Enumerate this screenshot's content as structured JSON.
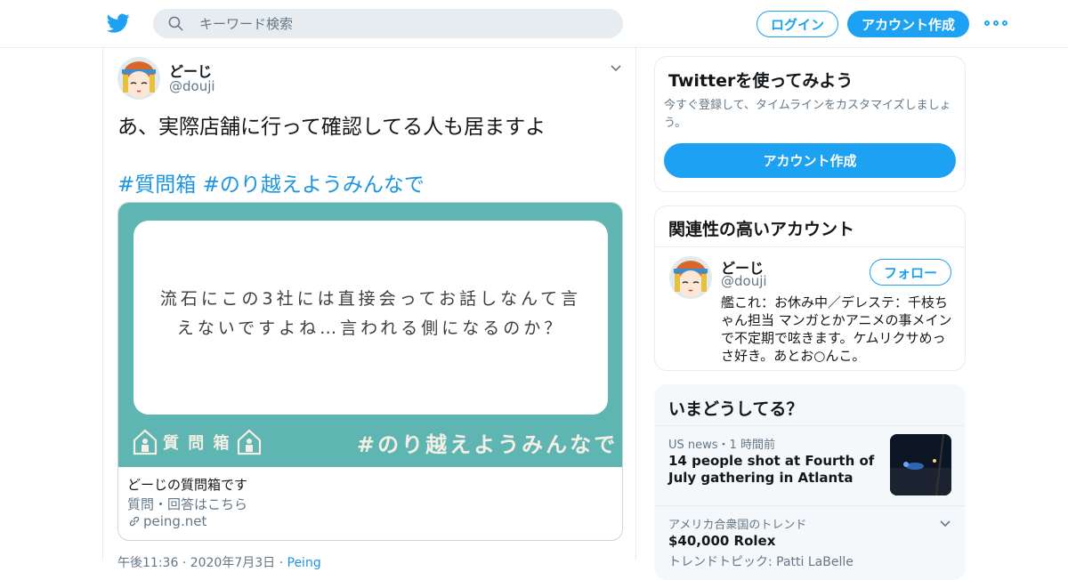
{
  "search": {
    "placeholder": "キーワード検索"
  },
  "header": {
    "login_label": "ログイン",
    "signup_label": "アカウント作成"
  },
  "tweet": {
    "name": "どーじ",
    "handle": "@douji",
    "text": "あ、実際店舗に行って確認してる人も居ますよ",
    "hashtags": "#質問箱 #のり越えようみんなで",
    "card": {
      "question_line1": "流石にこの3社には直接会ってお話しなんて言",
      "question_line2": "えないですよね…言われる側になるのか？",
      "brand": "質 問 箱",
      "hashtag": "#のり越えようみんなで",
      "title": "どーじの質問箱です",
      "description": "質問・回答はこちら",
      "domain": "peing.net"
    },
    "meta_time": "午後11:36 · 2020年7月3日 · ",
    "meta_source": "Peing"
  },
  "signup_panel": {
    "title": "Twitterを使ってみよう",
    "text": "今すぐ登録して、タイムラインをカスタマイズしましょう。",
    "button": "アカウント作成"
  },
  "related": {
    "title": "関連性の高いアカウント",
    "name": "どーじ",
    "handle": "@douji",
    "follow_label": "フォロー",
    "bio": "艦これ：お休み中／デレステ：千枝ちゃん担当 マンガとかアニメの事メインで不定期で呟きます。ケムリクサめっさ好き。あとお○んこ。"
  },
  "trends": {
    "title": "いまどうしてる？",
    "items": [
      {
        "context": "US news・1 時間前",
        "title": "14 people shot at Fourth of July gathering in Atlanta"
      },
      {
        "context": "アメリカ合衆国のトレンド",
        "title": "$40,000 Rolex",
        "sub": "トレンドトピック: Patti LaBelle"
      }
    ]
  },
  "colors": {
    "accent": "#1da1f2",
    "card_teal": "#5fb5b1",
    "link": "#1b95e0"
  }
}
